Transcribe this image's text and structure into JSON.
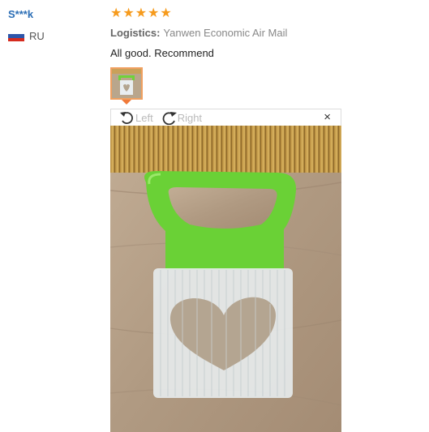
{
  "reviewer": {
    "name": "S***k",
    "country_code": "RU"
  },
  "review": {
    "rating": 5,
    "stars": [
      "★",
      "★",
      "★",
      "★",
      "★"
    ],
    "logistics_label": "Logistics:",
    "logistics_value": "Yanwen Economic Air Mail",
    "text": "All good. Recommend"
  },
  "viewer": {
    "rotate_left_label": "Left",
    "rotate_right_label": "Right",
    "close_glyph": "×"
  },
  "colors": {
    "name_link": "#2a6db5",
    "star": "#f69b1d",
    "selected_border": "#f0a060",
    "tool_green": "#6fd33a"
  }
}
